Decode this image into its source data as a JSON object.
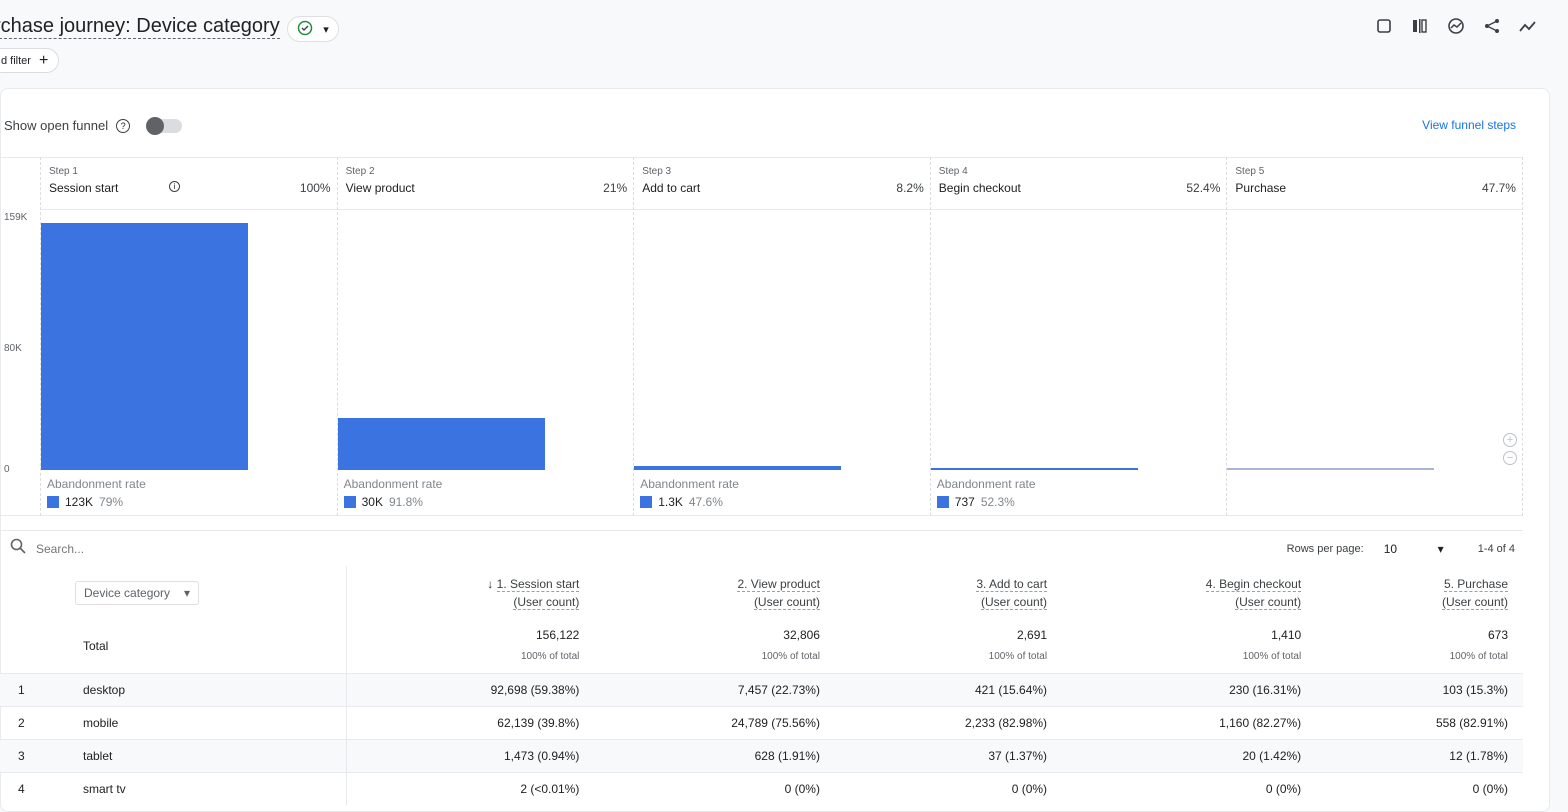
{
  "header": {
    "title": "rchase journey: Device category",
    "filter_label": "d filter",
    "icons": [
      "check-circle-icon",
      "note-icon",
      "compare-icon",
      "insights-icon",
      "share-icon",
      "trend-icon"
    ]
  },
  "controls": {
    "open_funnel_label": "Show open funnel",
    "open_funnel_on": false,
    "view_steps": "View funnel steps"
  },
  "chart_data": {
    "type": "bar",
    "ylim": [
      0,
      159000
    ],
    "yticks": [
      "159K",
      "80K",
      "0"
    ],
    "categories": [
      "Session start",
      "View product",
      "Add to cart",
      "Begin checkout",
      "Purchase"
    ],
    "values": [
      156122,
      32806,
      2691,
      1410,
      673
    ],
    "steps": [
      {
        "step": "Step 1",
        "label": "Session start",
        "pct": "100%",
        "ab_label": "Abandonment rate",
        "ab_count": "123K",
        "ab_pct": "79%"
      },
      {
        "step": "Step 2",
        "label": "View product",
        "pct": "21%",
        "ab_label": "Abandonment rate",
        "ab_count": "30K",
        "ab_pct": "91.8%"
      },
      {
        "step": "Step 3",
        "label": "Add to cart",
        "pct": "8.2%",
        "ab_label": "Abandonment rate",
        "ab_count": "1.3K",
        "ab_pct": "47.6%"
      },
      {
        "step": "Step 4",
        "label": "Begin checkout",
        "pct": "52.4%",
        "ab_label": "Abandonment rate",
        "ab_count": "737",
        "ab_pct": "52.3%"
      },
      {
        "step": "Step 5",
        "label": "Purchase",
        "pct": "47.7%"
      }
    ],
    "color": "#3b74e0"
  },
  "table": {
    "search_placeholder": "Search...",
    "rows_per_page_label": "Rows per page:",
    "rows_per_page": "10",
    "range": "1-4 of 4",
    "dimension": "Device category",
    "columns": [
      {
        "name": "1. Session start",
        "metric": "(User count)"
      },
      {
        "name": "2. View product",
        "metric": "(User count)"
      },
      {
        "name": "3. Add to cart",
        "metric": "(User count)"
      },
      {
        "name": "4. Begin checkout",
        "metric": "(User count)"
      },
      {
        "name": "5. Purchase",
        "metric": "(User count)"
      }
    ],
    "total": {
      "label": "Total",
      "values": [
        "156,122",
        "32,806",
        "2,691",
        "1,410",
        "673"
      ],
      "sub": "100% of total"
    },
    "rows": [
      {
        "n": "1",
        "name": "desktop",
        "values": [
          "92,698 (59.38%)",
          "7,457 (22.73%)",
          "421 (15.64%)",
          "230 (16.31%)",
          "103 (15.3%)"
        ]
      },
      {
        "n": "2",
        "name": "mobile",
        "values": [
          "62,139 (39.8%)",
          "24,789 (75.56%)",
          "2,233 (82.98%)",
          "1,160 (82.27%)",
          "558 (82.91%)"
        ]
      },
      {
        "n": "3",
        "name": "tablet",
        "values": [
          "1,473 (0.94%)",
          "628 (1.91%)",
          "37 (1.37%)",
          "20 (1.42%)",
          "12 (1.78%)"
        ]
      },
      {
        "n": "4",
        "name": "smart tv",
        "values": [
          "2 (<0.01%)",
          "0 (0%)",
          "0 (0%)",
          "0 (0%)",
          "0 (0%)"
        ]
      }
    ]
  }
}
